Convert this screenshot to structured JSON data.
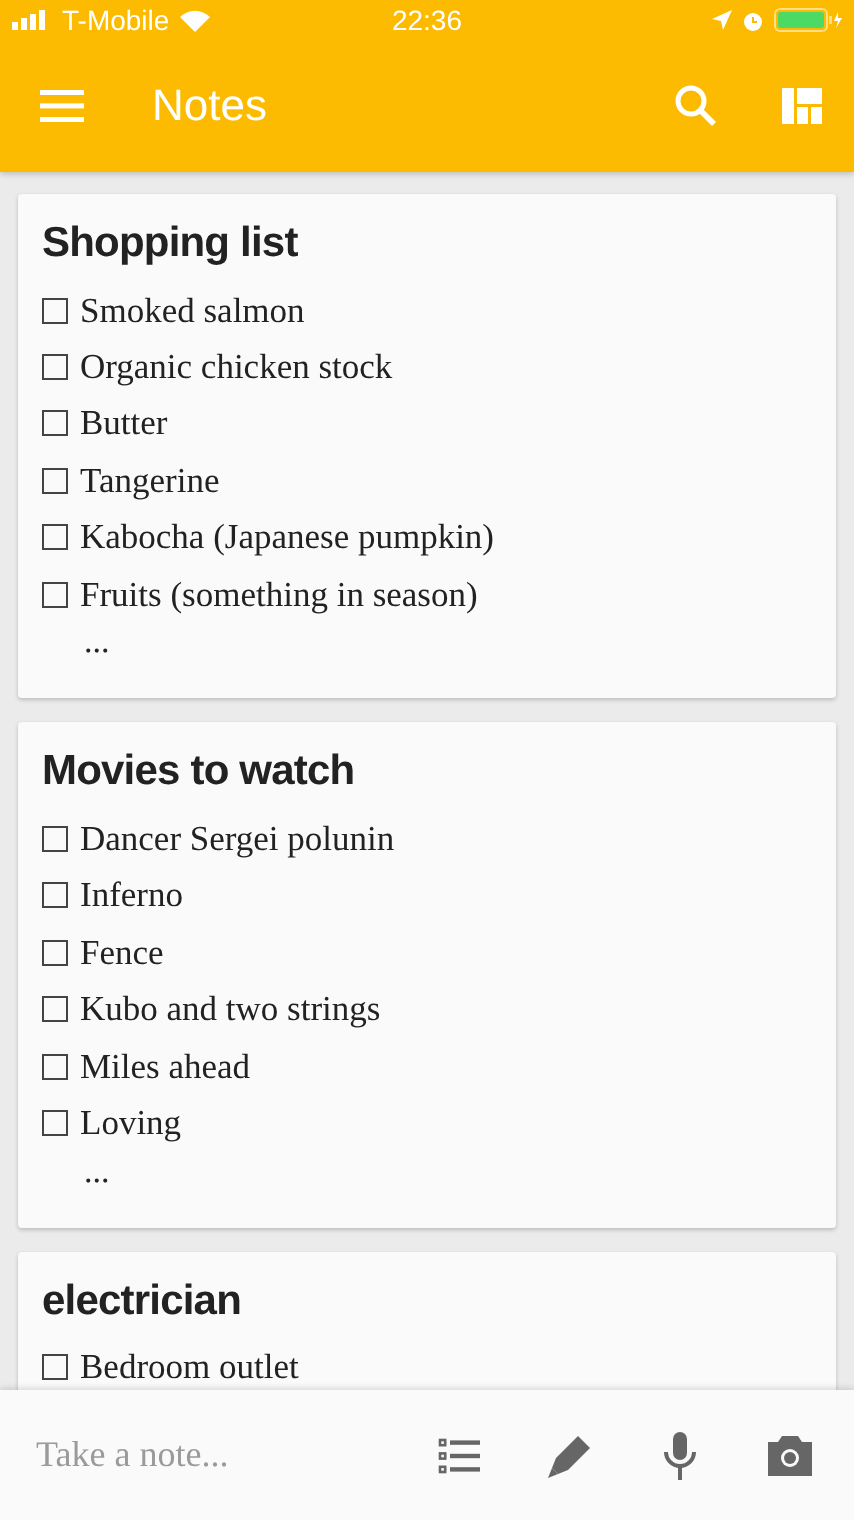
{
  "status_bar": {
    "carrier": "T-Mobile",
    "time": "22:36"
  },
  "app_bar": {
    "title": "Notes"
  },
  "notes": [
    {
      "title": "Shopping list",
      "items": [
        {
          "text": "Smoked salmon",
          "checked": false
        },
        {
          "text": "Organic chicken stock",
          "checked": false
        },
        {
          "text": "Butter",
          "checked": false
        },
        {
          "text": "Tangerine",
          "checked": false
        },
        {
          "text": "Kabocha (Japanese pumpkin)",
          "checked": false
        },
        {
          "text": "Fruits (something in season)",
          "checked": false
        }
      ],
      "more": "..."
    },
    {
      "title": "Movies to watch",
      "items": [
        {
          "text": "Dancer Sergei polunin",
          "checked": false
        },
        {
          "text": "Inferno",
          "checked": false
        },
        {
          "text": "Fence",
          "checked": false
        },
        {
          "text": "Kubo and two strings",
          "checked": false
        },
        {
          "text": "Miles ahead",
          "checked": false
        },
        {
          "text": "Loving",
          "checked": false
        }
      ],
      "more": "..."
    },
    {
      "title": "electrician",
      "items": [
        {
          "text": "Bedroom outlet",
          "checked": false
        }
      ]
    }
  ],
  "bottom_bar": {
    "placeholder": "Take a note..."
  }
}
